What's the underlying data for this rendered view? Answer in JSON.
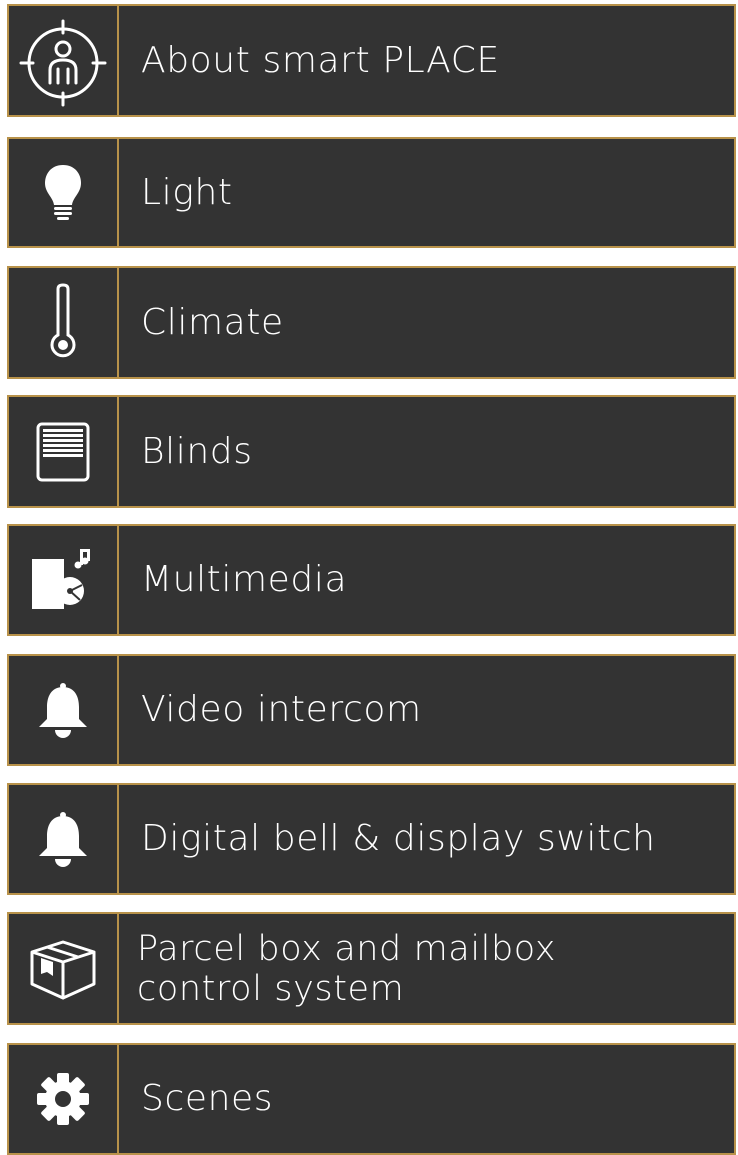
{
  "theme": {
    "item_background": "#333333",
    "border_color": "#b8924a",
    "text_color": "#ffffff",
    "page_background": "#ffffff"
  },
  "menu": {
    "items": [
      {
        "label": "About smart PLACE",
        "icon": "person-target-icon"
      },
      {
        "label": "Light",
        "icon": "light-bulb-icon"
      },
      {
        "label": "Climate",
        "icon": "thermometer-icon"
      },
      {
        "label": "Blinds",
        "icon": "blinds-icon"
      },
      {
        "label": "Multimedia",
        "icon": "multimedia-icon"
      },
      {
        "label": "Video intercom",
        "icon": "bell-icon"
      },
      {
        "label": "Digital bell & display switch",
        "icon": "bell-icon"
      },
      {
        "label": "Parcel box and mailbox\ncontrol system",
        "icon": "parcel-box-icon"
      },
      {
        "label": "Scenes",
        "icon": "gear-icon"
      }
    ]
  }
}
